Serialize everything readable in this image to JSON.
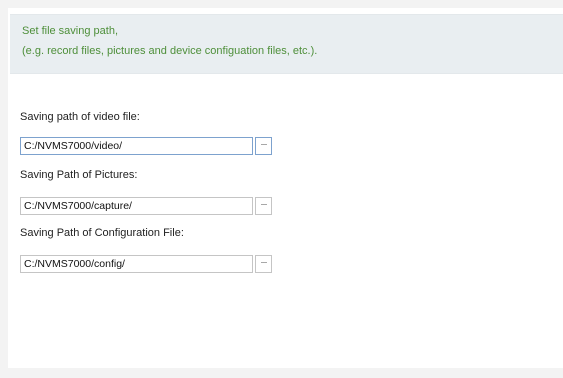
{
  "info": {
    "line1": "Set file saving path,",
    "line2": "(e.g. record files, pictures and device configuation files, etc.)."
  },
  "fields": [
    {
      "label": "Saving path of video file:",
      "value": "C:/NVMS7000/video/",
      "browse_label": "···"
    },
    {
      "label": "Saving Path of Pictures:",
      "value": "C:/NVMS7000/capture/",
      "browse_label": "···"
    },
    {
      "label": "Saving Path of Configuration File:",
      "value": "C:/NVMS7000/config/",
      "browse_label": "···"
    }
  ],
  "colors": {
    "info_text": "#4e8f3a",
    "info_background": "#e9eef1",
    "focus_border": "#7da2ce"
  }
}
